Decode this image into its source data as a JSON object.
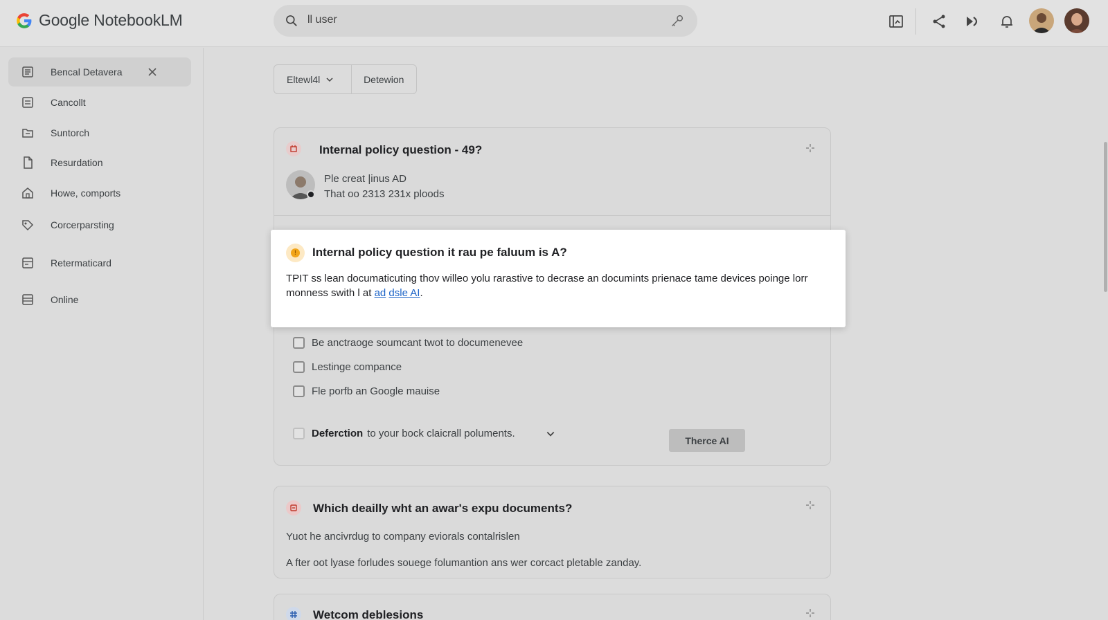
{
  "app": {
    "title": "Google NotebookLM",
    "brand_colors": [
      "#4285F4",
      "#EA4335",
      "#FBBC05",
      "#34A853"
    ]
  },
  "header": {
    "search_value": "ll user",
    "icons": [
      "search-icon",
      "key-icon",
      "notes-icon",
      "share-icon",
      "forward-icon",
      "bell-icon"
    ]
  },
  "sidebar": {
    "items": [
      {
        "label": "Bencal Detavera",
        "icon": "list-icon",
        "active": true
      },
      {
        "label": "Cancollt",
        "icon": "document-icon"
      },
      {
        "label": "Suntorch",
        "icon": "folder-icon"
      },
      {
        "label": "Resurdation",
        "icon": "file-icon"
      },
      {
        "label": "Howe, comports",
        "icon": "home-icon"
      },
      {
        "label": "Corcerparsting",
        "icon": "tag-icon"
      },
      {
        "label": "Retermaticard",
        "icon": "card-icon"
      },
      {
        "label": "Online",
        "icon": "stack-icon"
      }
    ]
  },
  "filters": {
    "first_label": "Eltewl4l",
    "second_label": "Detewion"
  },
  "card1": {
    "title": "Internal policy question - 49?",
    "line1": "Ple creat |inus AD",
    "line2": "That oo 2313 231x ploods"
  },
  "popup": {
    "title": "Internal policy question it rau pe faluum is A?",
    "body": "TPIT ss lean documaticuting thov willeo yolu rarastive to decrase an documints prienace tame devices poinge lorr monness swith l at ",
    "link1": "ad",
    "link2": "dsle AI",
    "period": "."
  },
  "checklist": {
    "items": [
      "Be anctraoge soumcant twot to documenevee",
      "Lestinge compance",
      "Fle porfb an Google mauise"
    ],
    "footer_bold": "Defercti​on",
    "footer_rest": "to your bock claicrall poluments.",
    "cta": "Therce AI"
  },
  "card3": {
    "title": "Which deailly wht an awar's expu documents?",
    "line1": "Yuot he ancivrdug to company eviorals contalrislen",
    "line2": "A fter oot lyase forludes souege folumantion ans wer corcact pletable zanday."
  },
  "card4": {
    "title": "Wetcom deblesions"
  }
}
